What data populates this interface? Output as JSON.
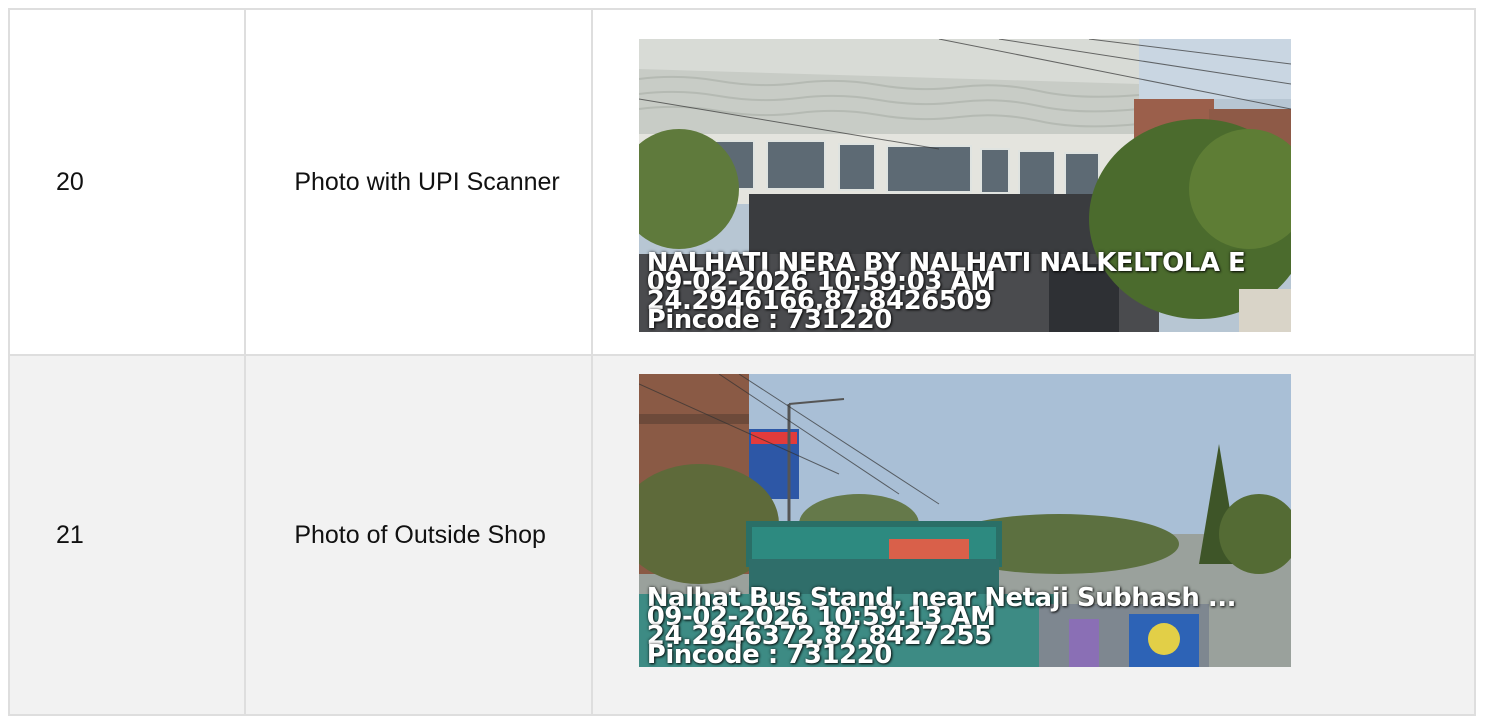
{
  "rows": [
    {
      "number": "20",
      "label": "Photo with UPI Scanner",
      "stamp": {
        "location": "NALHATI NERA BY NALHATI NALKELTOLA E",
        "datetime": "09-02-2026 10:59:03 AM",
        "coords": "24.2946166,87.8426509",
        "pincode": "Pincode : 731220"
      }
    },
    {
      "number": "21",
      "label": "Photo of Outside Shop",
      "stamp": {
        "location": "Nalhat Bus Stand, near Netaji Subhash ...",
        "datetime": "09-02-2026 10:59:13 AM",
        "coords": "24.2946372,87.8427255",
        "pincode": "Pincode : 731220"
      }
    }
  ]
}
